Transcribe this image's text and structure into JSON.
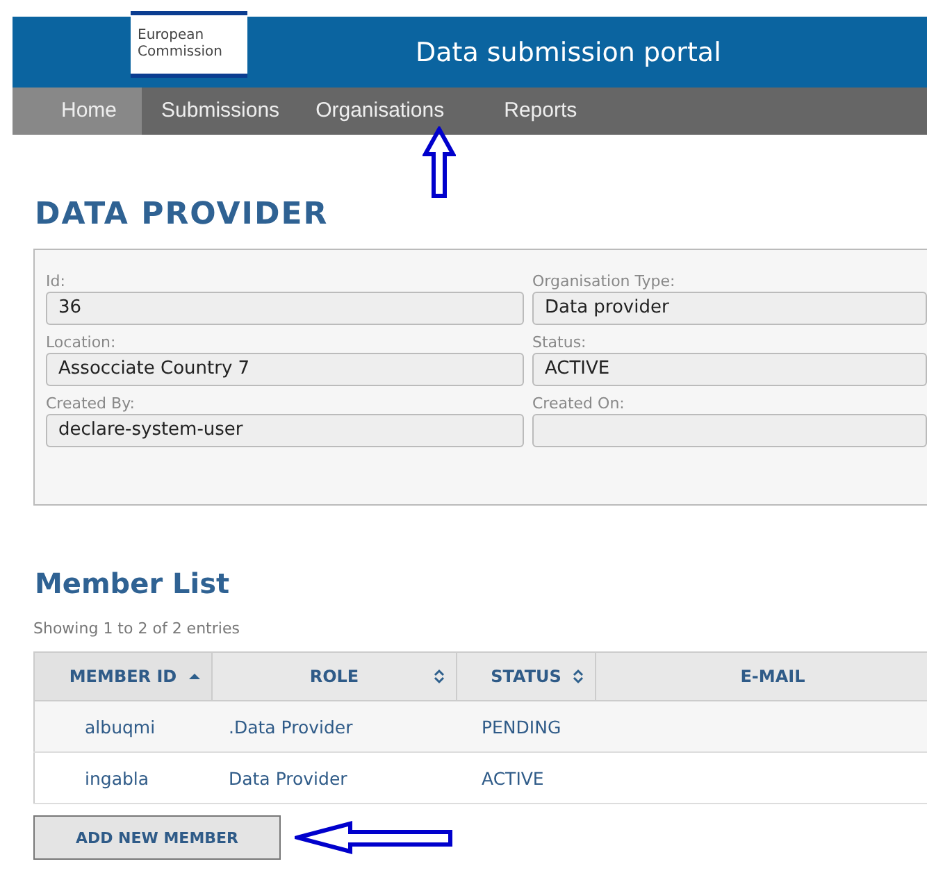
{
  "header": {
    "logo": [
      "European",
      "Commission"
    ],
    "title": "Data submission portal"
  },
  "nav": [
    {
      "label": "Home",
      "selected": true
    },
    {
      "label": "Submissions",
      "selected": false
    },
    {
      "label": "Organisations",
      "selected": false
    },
    {
      "label": "Reports",
      "selected": false
    }
  ],
  "page_title": "DATA PROVIDER",
  "form": [
    {
      "label": "Id:",
      "value": "36"
    },
    {
      "label": "Organisation Type:",
      "value": "Data provider"
    },
    {
      "label": "Location:",
      "value": "Assocciate Country 7"
    },
    {
      "label": "Status:",
      "value": "ACTIVE"
    },
    {
      "label": "Created By:",
      "value": "declare-system-user"
    },
    {
      "label": "Created On:"
    }
  ],
  "member_list": {
    "title": "Member List",
    "info": "Showing 1 to 2 of 2 entries",
    "columns": [
      {
        "label": "MEMBER ID",
        "sortable": true,
        "sorted": true
      },
      {
        "label": "ROLE",
        "sortable": true,
        "sorted": false
      },
      {
        "label": "STATUS",
        "sortable": true,
        "sorted": false
      },
      {
        "label": "E-MAIL"
      }
    ],
    "rows": [
      [
        "albuqmi",
        ".Data Provider",
        "PENDING"
      ],
      [
        "ingabla",
        "Data Provider",
        "ACTIVE"
      ]
    ]
  },
  "add_button": "ADD NEW MEMBER"
}
